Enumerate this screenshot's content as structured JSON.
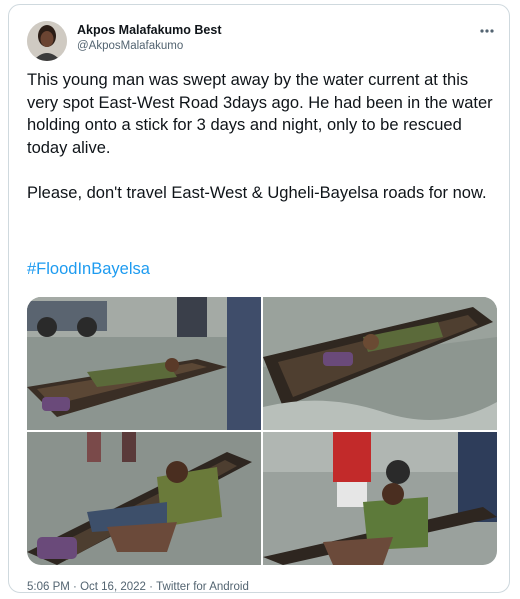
{
  "user": {
    "display_name": "Akpos Malafakumo Best",
    "handle": "@AkposMalafakumo"
  },
  "icons": {
    "more": "more-horizontal-icon"
  },
  "tweet": {
    "paragraph1": "This young man was swept away by the water current at this very spot East-West Road  3days ago. He had been in the water holding onto a stick for 3 days and night, only to be rescued today alive.",
    "paragraph2": "Please, don't travel East-West & Ugheli-Bayelsa roads for now.",
    "hashtag": "#FloodInBayelsa"
  },
  "meta": {
    "time": "5:06 PM",
    "separator1": " · ",
    "date": "Oct 16, 2022",
    "separator2": " · ",
    "source": "Twitter for Android"
  },
  "colors": {
    "link": "#1d9bf0",
    "secondary_text": "#536471",
    "border": "#cfd9de"
  }
}
